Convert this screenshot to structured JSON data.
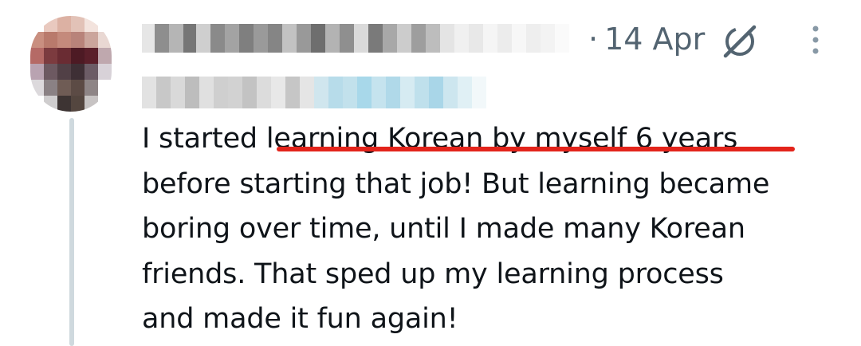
{
  "post": {
    "date_separator": "·",
    "date": "14 Apr",
    "text_lines": [
      "I started learning Korean by myself 6 years",
      "before starting that job! But learning became",
      "boring over time, until I made many Korean",
      "friends. That sped up my learning process",
      "and made it fun again!"
    ],
    "highlighted_phrase": "learning Korean by myself 6 years"
  },
  "icons": {
    "grok": "grok-icon",
    "more": "more-vertical-icon"
  },
  "colors": {
    "text": "#0f1419",
    "secondary_text": "#536471",
    "thread_line": "#cfd9de",
    "annotation_underline": "#e3241b",
    "handle_blur_accent": "#a8d8ea"
  }
}
